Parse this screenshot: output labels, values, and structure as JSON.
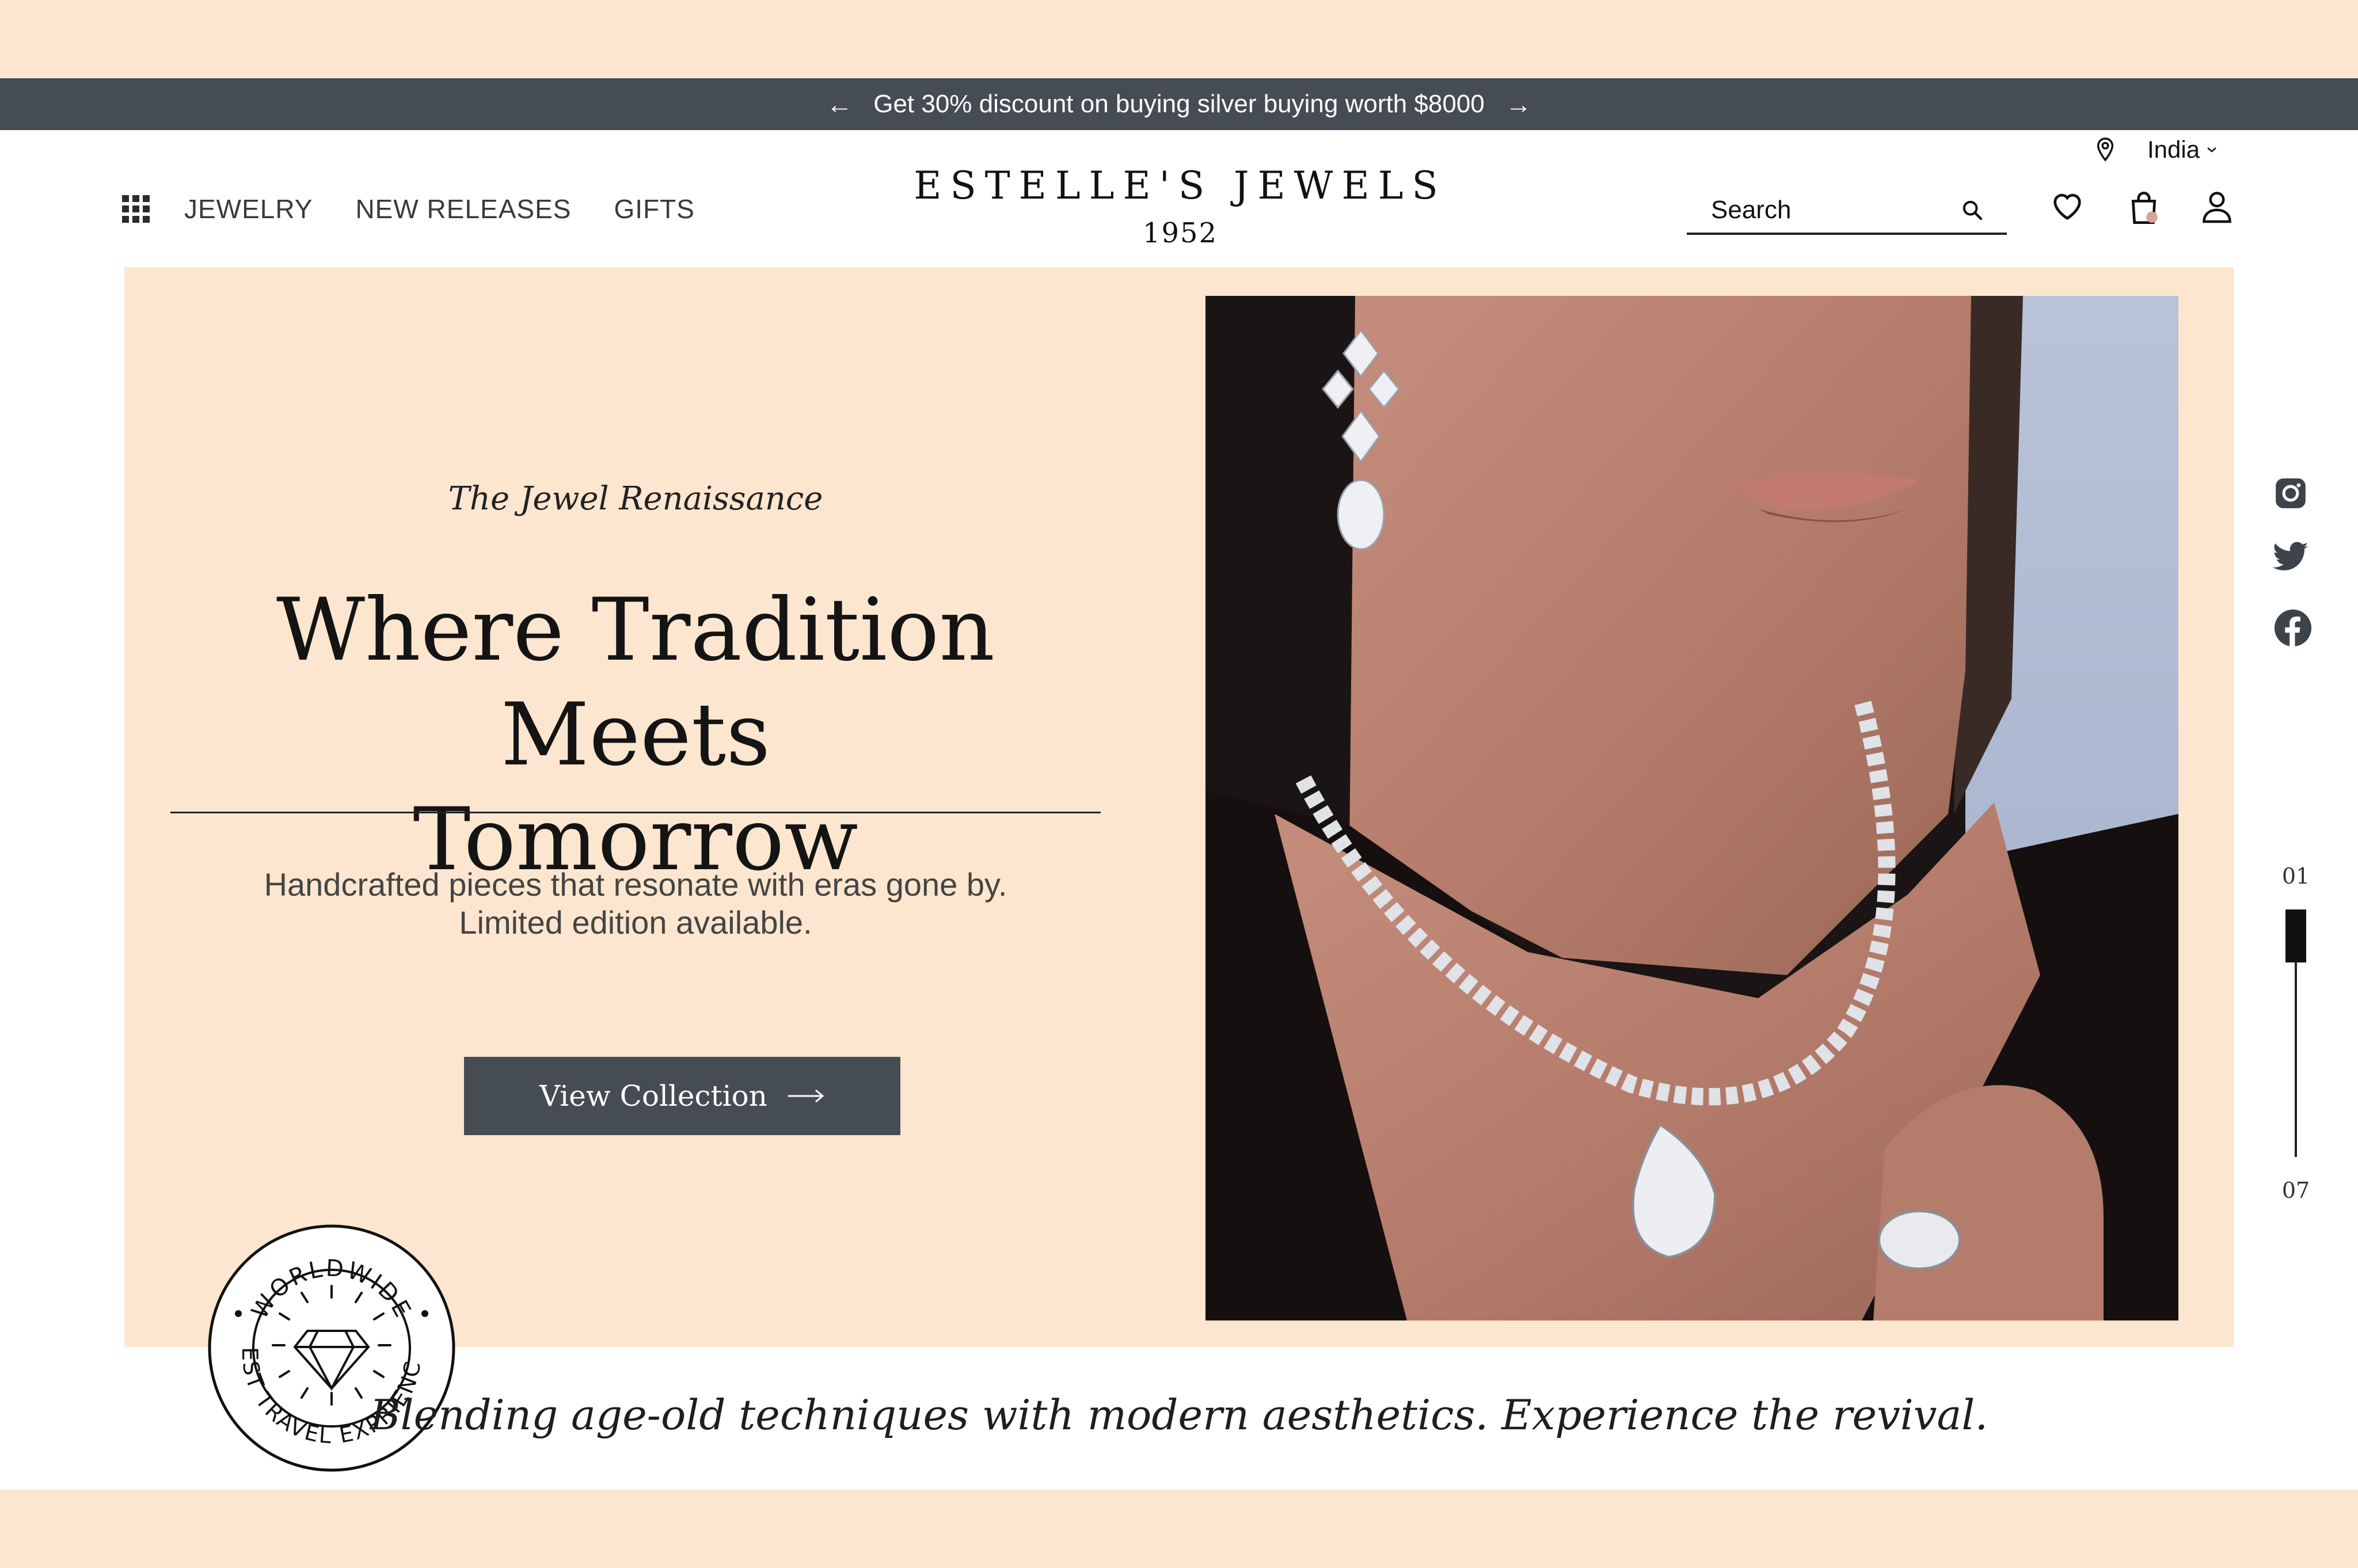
{
  "promo": {
    "text": "Get 30% discount on buying silver buying worth $8000",
    "prev_arrow": "←",
    "next_arrow": "→"
  },
  "nav": {
    "menu_icon": "grid-menu-icon",
    "links": [
      "JEWELRY",
      "NEW RELEASES",
      "GIFTS"
    ]
  },
  "brand": {
    "name": "ESTELLE'S JEWELS",
    "year": "1952"
  },
  "region": {
    "label": "India",
    "chevron": "⌄"
  },
  "search": {
    "placeholder": "Search",
    "value": ""
  },
  "header_icons": [
    "heart-icon",
    "shopping-bag-icon",
    "user-icon"
  ],
  "hero": {
    "tagline": "The Jewel Renaissance",
    "headline_line1": "Where Tradition Meets",
    "headline_line2": "Tomorrow",
    "subtext_line1": "Handcrafted pieces that resonate with eras gone by.",
    "subtext_line2": "Limited edition available.",
    "cta_label": "View Collection",
    "cta_arrow": "⟶"
  },
  "badge": {
    "top_text": "WORLDWIDE",
    "bottom_text": "BEST TRAVEL EXPRIENCES"
  },
  "blurb": "Blending age-old techniques with modern aesthetics. Experience the revival.",
  "social": [
    "instagram-icon",
    "twitter-icon",
    "facebook-icon"
  ],
  "slider": {
    "current": "01",
    "total": "07",
    "progress": 0.143
  },
  "colors": {
    "peach": "#fde6cf",
    "slate": "#464c53",
    "accent_dot": "#d9a395"
  }
}
